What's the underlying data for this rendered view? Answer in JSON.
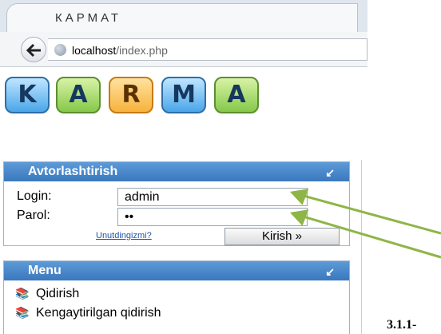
{
  "browser": {
    "tab_title": "КАРМАТ",
    "url_host": "localhost",
    "url_path": "/index.php"
  },
  "logo": {
    "letters": [
      "K",
      "A",
      "R",
      "M",
      "A"
    ]
  },
  "login_panel": {
    "title": "Avtorlashtirish",
    "login_label": "Login:",
    "login_value": "admin",
    "password_label": "Parol:",
    "password_value": "••",
    "forgot_link": "Unutdingizmi?",
    "submit_label": "Kirish »"
  },
  "menu_panel": {
    "title": "Menu",
    "items": [
      "Qidirish",
      "Kengaytirilgan qidirish"
    ]
  },
  "caption": "3.1.1-",
  "colors": {
    "panel_header": "#3a78bd",
    "arrow": "#8fb547"
  },
  "icons": {
    "collapse": "collapse-icon",
    "menu_item": "books-icon"
  }
}
